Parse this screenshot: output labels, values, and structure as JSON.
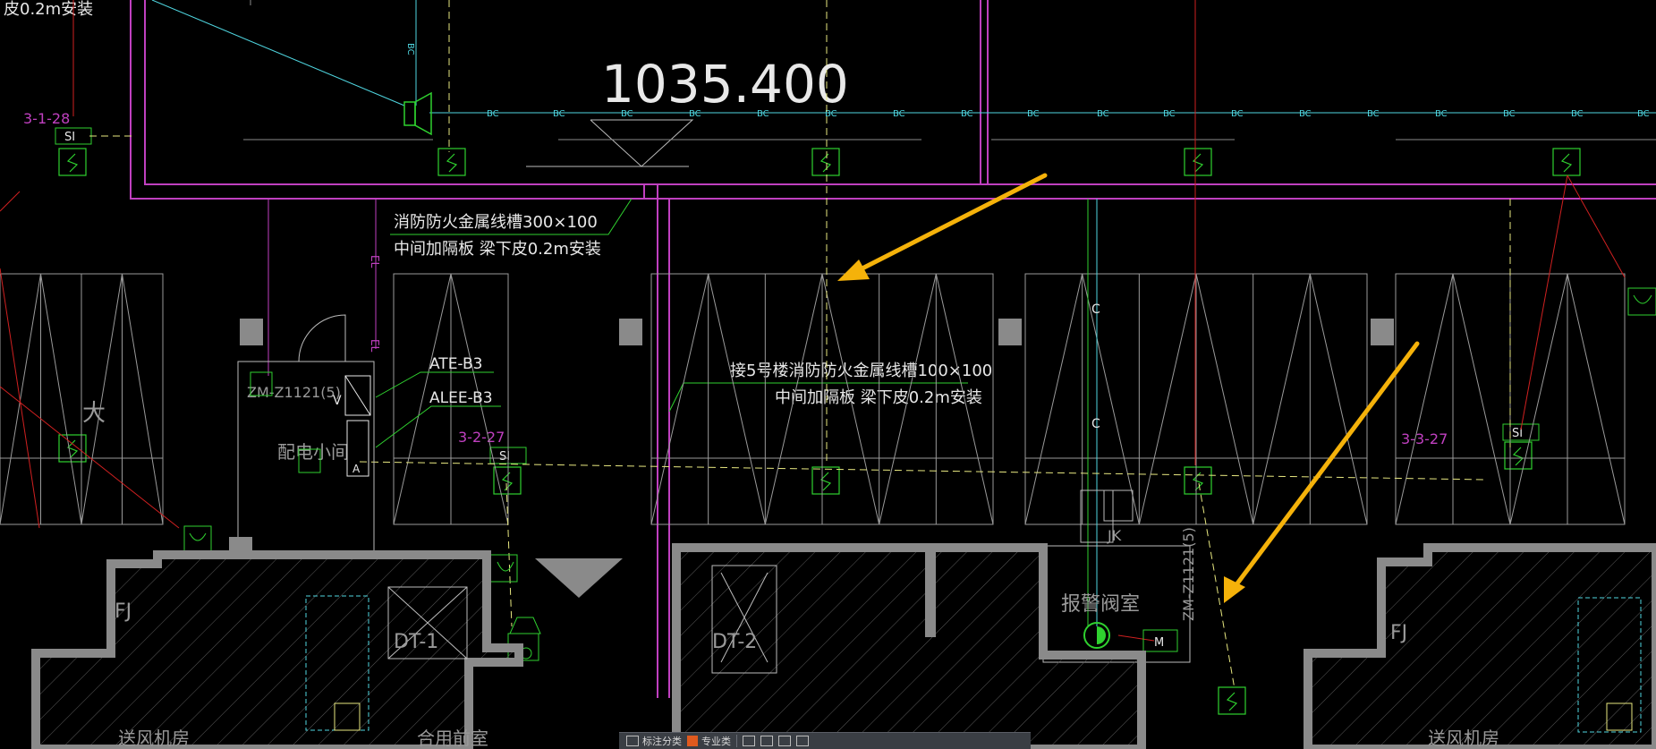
{
  "drawing": {
    "elevation": "1035.400",
    "tray_note_1_line1": "消防防火金属线槽300×100",
    "tray_note_1_line2": "中间加隔板 梁下皮0.2m安装",
    "tray_note_2_line1": "接5号楼消防防火金属线槽100×100",
    "tray_note_2_line2": "中间加隔板 梁下皮0.2m安装",
    "top_left_fragment": "皮0.2m安装",
    "panel_ate": "ATE-B3",
    "panel_alee": "ALEE-B3",
    "panel_ref_1": "ZM-Z1121(5)",
    "panel_ref_2": "ZM-Z1121(5)",
    "room_elec": "配电小间",
    "room_alarm": "报警阀室",
    "room_fan_1": "送风机房",
    "room_fan_2": "送风机房",
    "room_lobby": "合用前室",
    "elevator_1": "DT-1",
    "elevator_2": "DT-2",
    "shaft_fj_1": "FJ",
    "shaft_fj_2": "FJ",
    "label_jk": "JK",
    "label_big": "大",
    "loop_1": "3-1-28",
    "loop_2": "3-2-27",
    "loop_3": "3-3-27",
    "tag_si": "SI",
    "tag_bc": "BC",
    "tag_el": "EL",
    "tag_c": "C",
    "tag_m": "M",
    "tag_a": "A",
    "tag_v": "V"
  },
  "colors": {
    "magenta": "#c040c0",
    "green": "#2fd12f",
    "cyan": "#4fd6e0",
    "yellow_dash": "#e8e880",
    "red": "#d02020",
    "white": "#e8e8e8",
    "gray_wall": "#8a8a8a",
    "arrow": "#f5b20a"
  },
  "toolbar": {
    "item_1": "标注分类",
    "item_2": "专业类"
  }
}
